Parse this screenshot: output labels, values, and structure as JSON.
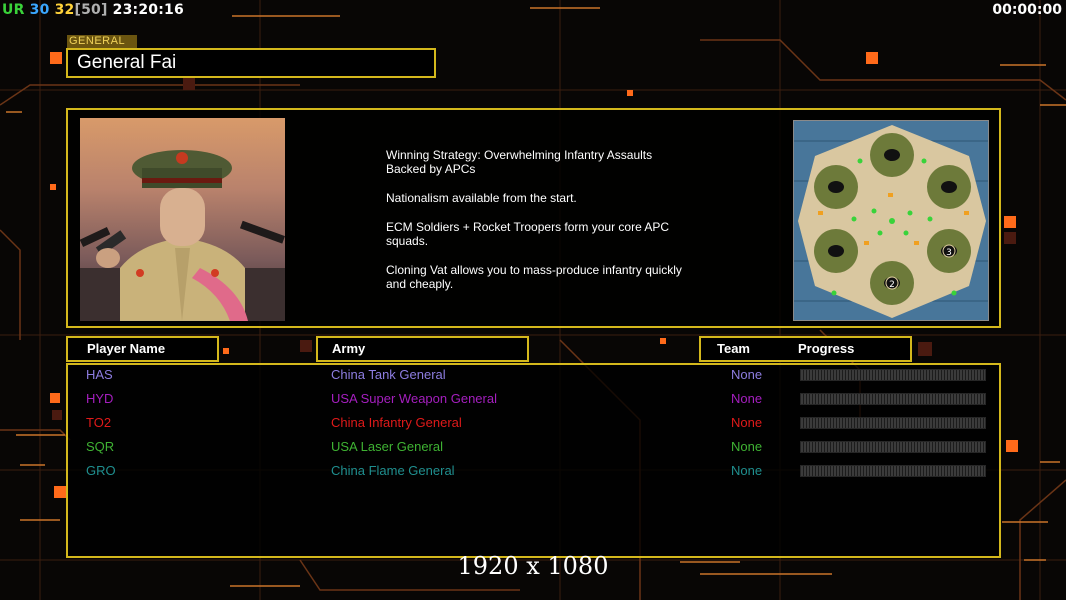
{
  "hud": {
    "ur_label": "UR",
    "ur_value": "30",
    "fps": "32",
    "fps_cap": "[50]",
    "time": "23:20:16",
    "game_timer": "00:00:00"
  },
  "general": {
    "tag": "GENERAL",
    "name": "General Fai"
  },
  "strategy": [
    "Winning Strategy: Overwhelming Infantry Assaults\n Backed by APCs",
    "Nationalism available from the start.",
    "ECM Soldiers + Rocket Troopers form your core APC\n squads.",
    "Cloning Vat allows you to mass-produce infantry quickly\n and cheaply."
  ],
  "minimap": {
    "start_labels": [
      "3",
      "2"
    ]
  },
  "table": {
    "headers": {
      "player": "Player Name",
      "army": "Army",
      "team": "Team",
      "progress": "Progress"
    },
    "rows": [
      {
        "name": "HAS",
        "army": "China Tank General",
        "team": "None",
        "color": "#8d7de0",
        "progress": 0
      },
      {
        "name": "HYD",
        "army": "USA Super Weapon General",
        "team": "None",
        "color": "#a51fbf",
        "progress": 0
      },
      {
        "name": "TO2",
        "army": "China Infantry General",
        "team": "None",
        "color": "#e01a1a",
        "progress": 0
      },
      {
        "name": "SQR",
        "army": "USA Laser General",
        "team": "None",
        "color": "#3fb233",
        "progress": 0
      },
      {
        "name": "GRO",
        "army": "China Flame General",
        "team": "None",
        "color": "#1f8f8f",
        "progress": 0
      }
    ]
  },
  "resolution_text": "1920 x 1080",
  "colors": {
    "frame": "#d4b81c",
    "accent_orange": "#ff7a1a",
    "ur": "#3ad33a",
    "fps": "#3aa7ff",
    "fps_cap": "#ffd23a"
  }
}
